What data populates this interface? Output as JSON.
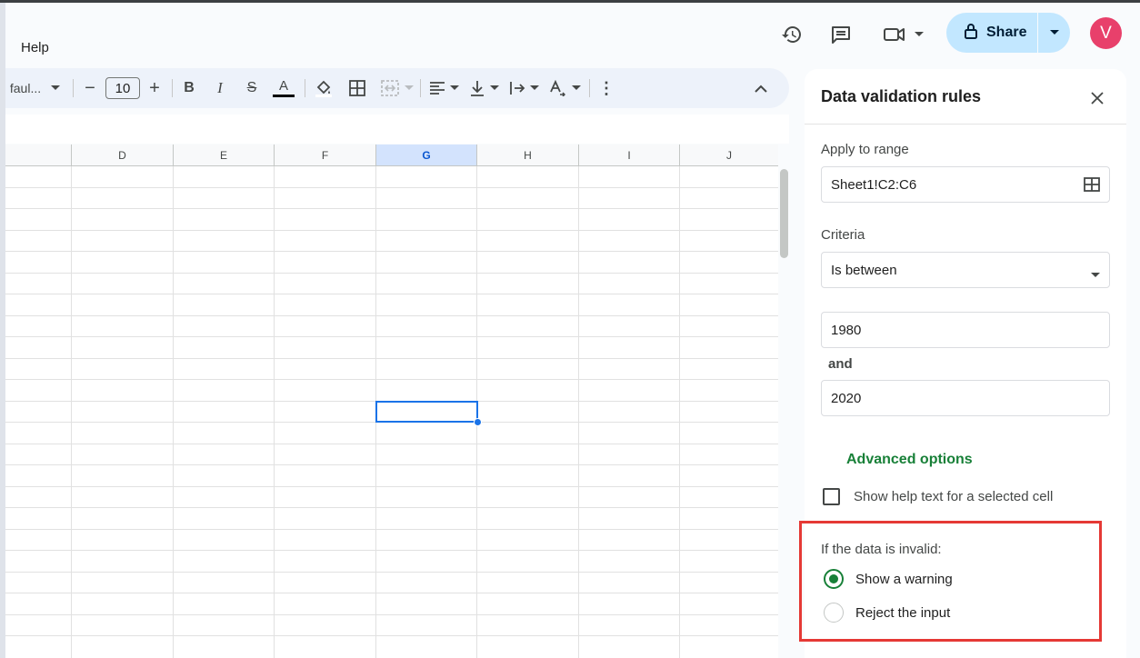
{
  "menu": {
    "help": "Help"
  },
  "top_icons": [
    "history-icon",
    "comment-icon",
    "video-call-icon",
    "chevron-down-icon"
  ],
  "share": {
    "label": "Share",
    "icon": "lock-icon"
  },
  "avatar": {
    "initial": "V",
    "color": "#e8406b"
  },
  "toolbar": {
    "font_name": "faul...",
    "font_size": "10",
    "minus": "−",
    "plus": "+",
    "bold": "B",
    "italic": "I",
    "strike": "S",
    "text_color": "A",
    "more": "⋮"
  },
  "grid": {
    "columns": [
      "D",
      "E",
      "F",
      "G",
      "H",
      "I",
      "J"
    ],
    "selected_column": "G"
  },
  "panel": {
    "title": "Data validation rules",
    "apply_label": "Apply to range",
    "range_value": "Sheet1!C2:C6",
    "criteria_label": "Criteria",
    "criteria_value": "Is between",
    "min_value": "1980",
    "and_label": "and",
    "max_value": "2020",
    "advanced": "Advanced options",
    "help_text_label": "Show help text for a selected cell",
    "invalid_label": "If the data is invalid:",
    "option_warning": "Show a warning",
    "option_reject": "Reject the input",
    "selected_option": "Show a warning"
  },
  "colors": {
    "accent_green": "#188038",
    "selection_blue": "#1a73e8",
    "share_bg": "#c2e7ff",
    "highlight_red": "#e53935"
  }
}
